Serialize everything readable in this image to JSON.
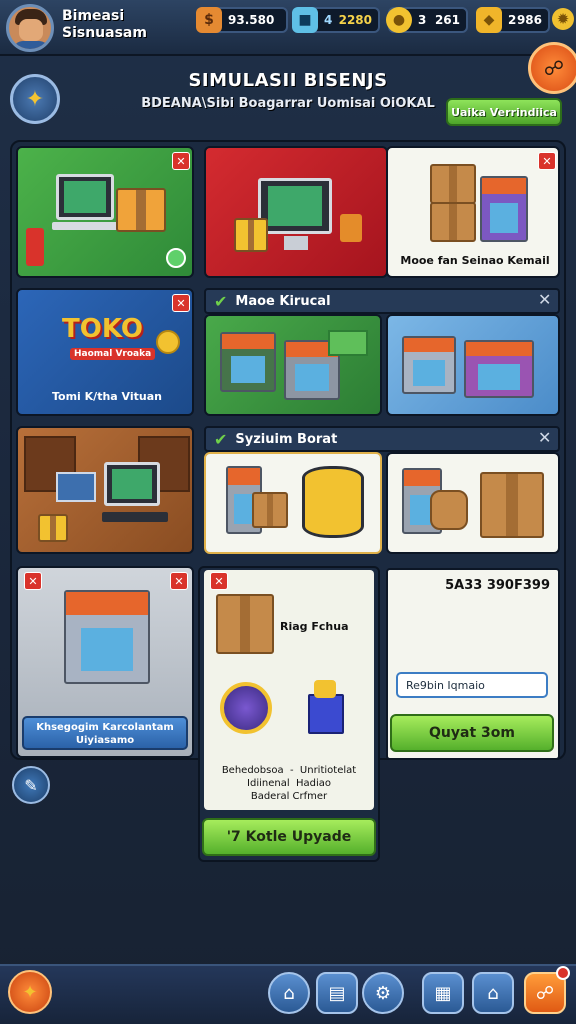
{
  "topbar": {
    "player_name": "Bimeasi\nSisnuasam",
    "resources": [
      {
        "icon": "cash-icon",
        "value": "93.580",
        "color": "#e58a32"
      },
      {
        "icon": "crate-icon",
        "value": "4",
        "value2": "2280",
        "color": "#5fc0e6"
      },
      {
        "icon": "coin-icon",
        "value": "3",
        "value2": "261",
        "color": "#f2c230"
      },
      {
        "icon": "gem-icon",
        "value": "2",
        "value2": "986",
        "color": "#f0b52a"
      }
    ],
    "settings_icon": "gear-icon"
  },
  "header": {
    "title": "SIMULASII BISENJS",
    "subtitle": "BDEANA\\Sibi Boagarrar Uomisai OiOKAL",
    "action_label": "Uaika Verrindiica"
  },
  "cards": {
    "shop_computer_label": "",
    "warehouse_label": "Mooe fan Seinao Kemail",
    "toko_logo": "TOKO",
    "toko_subtitle": "Haomal Vroaka",
    "toko_label": "Tomi K/tha Vituan",
    "section1_title": "Maoe Kirucal",
    "section2_title": "Syziuim Borat",
    "building_label": "Khsegogim Karcolantam\nUiyiasamo"
  },
  "detail": {
    "item_title": "Riag Fchua",
    "description": "Behedobsoa  -  Unritiotelat\nIdiinenal  Hadiao\nBaderal Crfmer",
    "upgrade_label": "'7 Kotle Upyade"
  },
  "side": {
    "code": "5A33 390F399",
    "input_value": "Re9bin Iqmaio",
    "button_label": "Quyat 3om"
  },
  "bottom_nav": [
    "back-icon",
    "home-icon",
    "inventory-icon",
    "settings-icon",
    "grid-icon",
    "store-icon",
    "alert-icon"
  ],
  "colors": {
    "accent_green": "#55b02c",
    "close_red": "#d9332b",
    "panel_bg": "#1b2a40"
  }
}
